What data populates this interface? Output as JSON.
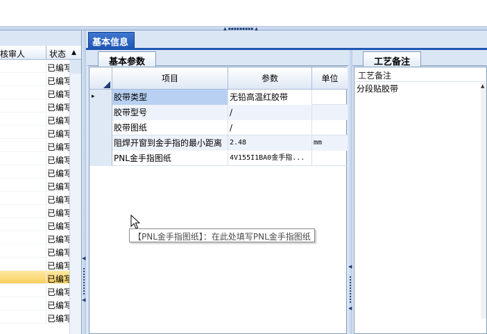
{
  "left_list": {
    "columns": [
      "核审人",
      "状态"
    ],
    "rows": [
      "已编写",
      "已编写",
      "已编写",
      "已编写",
      "已编写",
      "已编写",
      "已编写",
      "已编写",
      "已编写",
      "已编写",
      "已编写",
      "已编写",
      "已编写",
      "已编写",
      "已编写",
      "已编写",
      "已编写",
      "已编写",
      "已编写",
      "已编写"
    ],
    "selected_index": 16,
    "sort_glyph": "▲"
  },
  "main_tab": {
    "label": "基本信息"
  },
  "params_panel": {
    "tab_label": "基本参数",
    "grid": {
      "columns": [
        "项目",
        "参数",
        "单位"
      ],
      "rows": [
        {
          "indicator": "▸",
          "name": "胶带类型",
          "value": "无铅高温红胶带",
          "unit": ""
        },
        {
          "indicator": "",
          "name": "胶带型号",
          "value": "/",
          "unit": ""
        },
        {
          "indicator": "",
          "name": "胶带图纸",
          "value": "/",
          "unit": ""
        },
        {
          "indicator": "",
          "name": "阻焊开窗到金手指的最小距离",
          "value": "2.48",
          "unit": "mm"
        },
        {
          "indicator": "",
          "name": "PNL金手指图纸",
          "value": "4V155I1BA0金手指...",
          "unit": ""
        }
      ]
    },
    "tooltip": "【PNL金手指图纸】：在此处填写PNL金手指图纸"
  },
  "notes_panel": {
    "tab_label": "工艺备注",
    "field_label": "工艺备注",
    "value": "分段贴胶带"
  },
  "colors": {
    "tab_active": "#1f56b3",
    "panel_bg": "#dbe6f5",
    "selection": "#f7cf5c",
    "cell_selected": "#b8d1f2"
  },
  "icons": {
    "splitter_grip": "••••••••••",
    "sort_up": "▲",
    "scroll_up": "▲"
  }
}
